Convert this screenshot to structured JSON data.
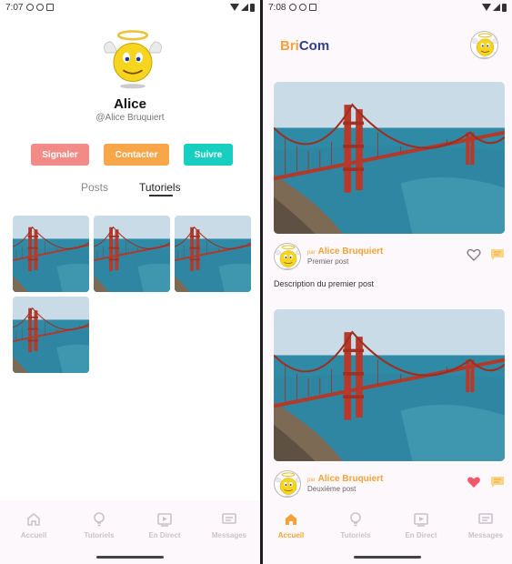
{
  "left_screen": {
    "status": {
      "time": "7:07"
    },
    "profile": {
      "name": "Alice",
      "handle": "@Alice Bruquiert",
      "buttons": {
        "report": "Signaler",
        "contact": "Contacter",
        "follow": "Suivre"
      },
      "tabs": {
        "posts": "Posts",
        "tutorials": "Tutoriels",
        "active": "Tutoriels"
      },
      "thumbnail_count": 4
    },
    "nav": [
      {
        "label": "Accueil",
        "icon": "home-icon",
        "active": false
      },
      {
        "label": "Tutoriels",
        "icon": "lightbulb-icon",
        "active": false
      },
      {
        "label": "En Direct",
        "icon": "live-video-icon",
        "active": false
      },
      {
        "label": "Messages",
        "icon": "message-icon",
        "active": false
      }
    ]
  },
  "right_screen": {
    "status": {
      "time": "7:08"
    },
    "logo": {
      "part1": "Bri",
      "part2": "Com"
    },
    "posts": [
      {
        "by_prefix": "par",
        "author": "Alice Bruquiert",
        "title": "Premier post",
        "description": "Description du premier post",
        "liked": false
      },
      {
        "by_prefix": "par",
        "author": "Alice Bruquiert",
        "title": "Deuxième post",
        "description": "",
        "liked": true
      }
    ],
    "nav": [
      {
        "label": "Accueil",
        "icon": "home-icon",
        "active": true
      },
      {
        "label": "Tutoriels",
        "icon": "lightbulb-icon",
        "active": false
      },
      {
        "label": "En Direct",
        "icon": "live-video-icon",
        "active": false
      },
      {
        "label": "Messages",
        "icon": "message-icon",
        "active": false
      }
    ]
  },
  "colors": {
    "accent": "#f7a238",
    "report": "#f28b86",
    "contact": "#f7a64a",
    "follow": "#17cfc0",
    "heart_liked": "#ee5a6a",
    "logo_dark": "#2f3e8f"
  }
}
